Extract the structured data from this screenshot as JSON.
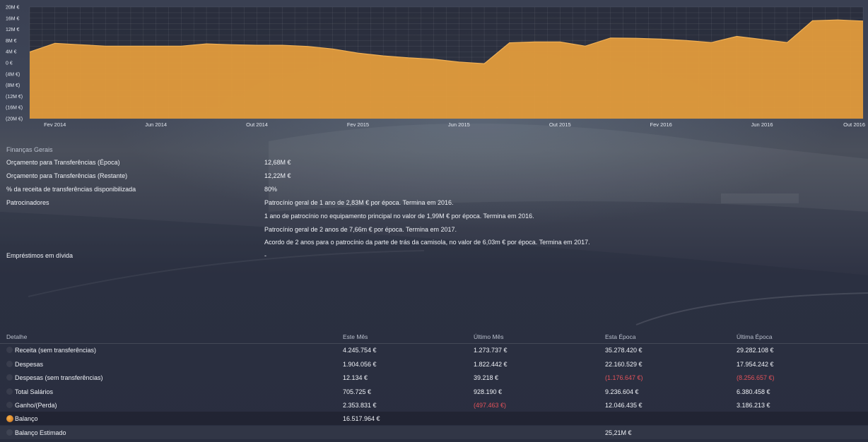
{
  "chart_data": {
    "type": "area",
    "x": [
      "Jan 2014",
      "Fev 2014",
      "Mar 2014",
      "Abr 2014",
      "Mai 2014",
      "Jun 2014",
      "Jul 2014",
      "Ago 2014",
      "Set 2014",
      "Out 2014",
      "Nov 2014",
      "Dez 2014",
      "Jan 2015",
      "Fev 2015",
      "Mar 2015",
      "Abr 2015",
      "Mai 2015",
      "Jun 2015",
      "Jul 2015",
      "Ago 2015",
      "Set 2015",
      "Out 2015",
      "Nov 2015",
      "Dez 2015",
      "Jan 2016",
      "Fev 2016",
      "Mar 2016",
      "Abr 2016",
      "Mai 2016",
      "Jun 2016",
      "Jul 2016",
      "Ago 2016",
      "Set 2016",
      "Out 2016"
    ],
    "series": [
      {
        "values": [
          3.9,
          7.0,
          6.5,
          6.0,
          6.0,
          6.0,
          6.0,
          6.8,
          6.5,
          6.3,
          6.3,
          5.9,
          5.0,
          3.5,
          2.5,
          1.8,
          1.3,
          0.3,
          -0.3,
          7.2,
          7.5,
          7.5,
          6.0,
          8.9,
          8.8,
          8.5,
          8.0,
          7.3,
          9.5,
          8.4,
          7.3,
          15.1,
          15.4,
          15.0
        ]
      }
    ],
    "yticks": [
      "20M €",
      "16M €",
      "12M €",
      "8M €",
      "4M €",
      "0 €",
      "(4M €)",
      "(8M €)",
      "(12M €)",
      "(16M €)",
      "(20M €)"
    ],
    "xticks": [
      "Fev 2014",
      "Jun 2014",
      "Out 2014",
      "Fev 2015",
      "Jun 2015",
      "Out 2015",
      "Fev 2016",
      "Jun 2016",
      "Out 2016"
    ],
    "ylim": [
      -20,
      20
    ],
    "grid": true,
    "color": "#e79e3c"
  },
  "finances": {
    "title": "Finanças Gerais",
    "rows": [
      {
        "label": "Orçamento para Transferências (Época)",
        "value": "12,68M €"
      },
      {
        "label": "Orçamento para Transferências (Restante)",
        "value": "12,22M €"
      },
      {
        "label": "% da receita de transferências disponibilizada",
        "value": "80%"
      },
      {
        "label": "Patrocinadores",
        "value": "Patrocínio geral de 1 ano de 2,83M € por época. Termina em 2016."
      },
      {
        "label": "",
        "value": "1 ano de patrocínio no equipamento principal no valor de 1,99M € por época. Termina em 2016."
      },
      {
        "label": "",
        "value": "Patrocínio geral de 2 anos de 7,66m € por época. Termina em 2017."
      },
      {
        "label": "",
        "value": "Acordo de 2 anos para o patrocínio da parte de trás da camisola, no valor de 6,03m € por época. Termina em 2017."
      },
      {
        "label": "Empréstimos em dívida",
        "value": "-"
      }
    ]
  },
  "detail": {
    "headers": [
      "Detalhe",
      "Este Mês",
      "Último Mês",
      "Esta Época",
      "Última Época"
    ],
    "rows": [
      {
        "name": "Receita (sem transferências)",
        "c1": "4.245.754 €",
        "c2": "1.273.737 €",
        "c3": "35.278.420 €",
        "c4": "29.282.108 €"
      },
      {
        "name": "Despesas",
        "c1": "1.904.056 €",
        "c2": "1.822.442 €",
        "c3": "22.160.529 €",
        "c4": "17.954.242 €"
      },
      {
        "name": "Despesas (sem transferências)",
        "c1": "12.134 €",
        "c2": "39.218 €",
        "c3": "(1.176.647 €)",
        "c4": "(8.256.657 €)"
      },
      {
        "name": "Total Salários",
        "c1": "705.725 €",
        "c2": "928.190 €",
        "c3": "9.236.604 €",
        "c4": "6.380.458 €"
      },
      {
        "name": "Ganho/(Perda)",
        "c1": "2.353.831 €",
        "c2": "(497.463 €)",
        "c3": "12.046.435 €",
        "c4": "3.186.213 €"
      },
      {
        "name": "Balanço",
        "c1": "16.517.964 €",
        "c2": "",
        "c3": "",
        "c4": ""
      },
      {
        "name": "Balanço Estimado",
        "c1": "",
        "c2": "",
        "c3": "25,21M €",
        "c4": ""
      }
    ],
    "negative_color": "#e0525a"
  }
}
